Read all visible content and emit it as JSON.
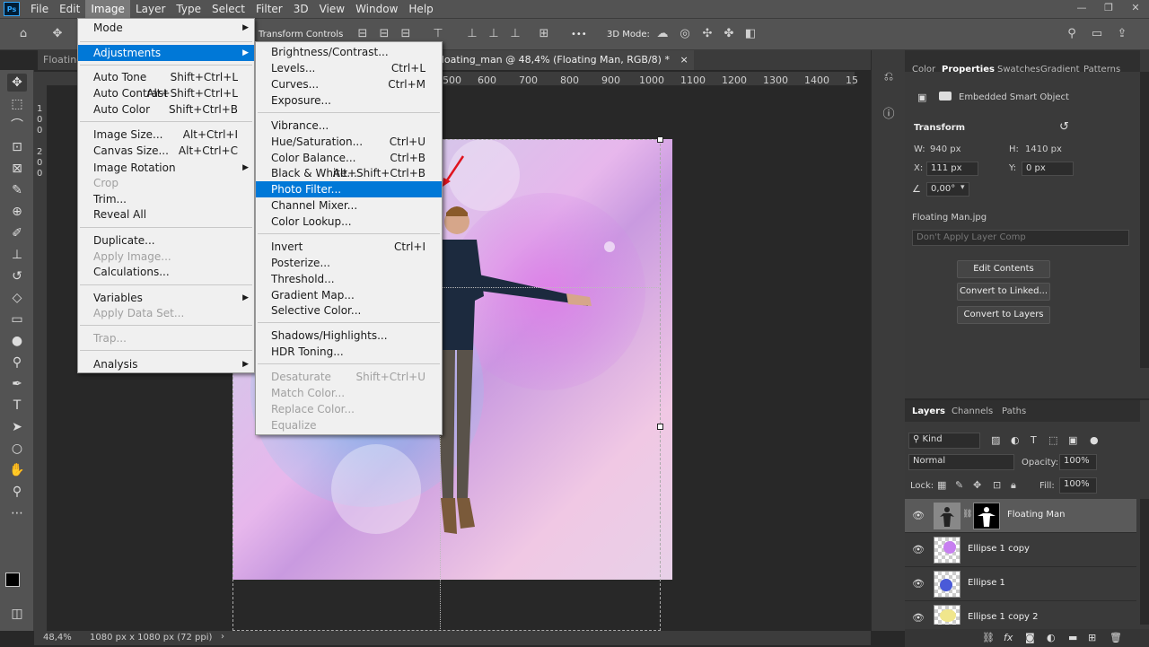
{
  "app": {
    "logo": "Ps"
  },
  "menubar": [
    "File",
    "Edit",
    "Image",
    "Layer",
    "Type",
    "Select",
    "Filter",
    "3D",
    "View",
    "Window",
    "Help"
  ],
  "window_controls": [
    "—",
    "❐",
    "✕"
  ],
  "options": {
    "transform_controls": "Transform Controls",
    "mode_3d": "3D Mode:",
    "more": "•••"
  },
  "tabs": {
    "left_tab": "Floating",
    "doc_tab": "floating_man @ 48,4% (Floating Man, RGB/8) *",
    "close": "×"
  },
  "ruler_top": [
    "500",
    "600",
    "700",
    "800",
    "900",
    "1000",
    "1100",
    "1200",
    "1300",
    "1400",
    "15"
  ],
  "ruler_left": [
    "1",
    "0",
    "0",
    "2",
    "0",
    "0"
  ],
  "status": {
    "zoom": "48,4%",
    "doc_info": "1080 px x 1080 px (72 ppi)",
    "arrow": "›"
  },
  "image_menu": {
    "items": [
      {
        "label": "Mode",
        "arrow": "▶"
      },
      {
        "label": "Adjustments",
        "arrow": "▶",
        "highlight": true
      },
      {
        "label": "Auto Tone",
        "shortcut": "Shift+Ctrl+L"
      },
      {
        "label": "Auto Contrast",
        "shortcut": "Alt+Shift+Ctrl+L"
      },
      {
        "label": "Auto Color",
        "shortcut": "Shift+Ctrl+B"
      },
      {
        "label": "Image Size...",
        "shortcut": "Alt+Ctrl+I"
      },
      {
        "label": "Canvas Size...",
        "shortcut": "Alt+Ctrl+C"
      },
      {
        "label": "Image Rotation",
        "arrow": "▶"
      },
      {
        "label": "Crop",
        "disabled": true
      },
      {
        "label": "Trim..."
      },
      {
        "label": "Reveal All"
      },
      {
        "label": "Duplicate..."
      },
      {
        "label": "Apply Image...",
        "disabled": true
      },
      {
        "label": "Calculations..."
      },
      {
        "label": "Variables",
        "arrow": "▶"
      },
      {
        "label": "Apply Data Set...",
        "disabled": true
      },
      {
        "label": "Trap...",
        "disabled": true
      },
      {
        "label": "Analysis",
        "arrow": "▶"
      }
    ]
  },
  "adjustments_menu": {
    "items": [
      {
        "label": "Brightness/Contrast..."
      },
      {
        "label": "Levels...",
        "shortcut": "Ctrl+L"
      },
      {
        "label": "Curves...",
        "shortcut": "Ctrl+M"
      },
      {
        "label": "Exposure..."
      },
      {
        "label": "Vibrance..."
      },
      {
        "label": "Hue/Saturation...",
        "shortcut": "Ctrl+U"
      },
      {
        "label": "Color Balance...",
        "shortcut": "Ctrl+B"
      },
      {
        "label": "Black & White...",
        "shortcut": "Alt+Shift+Ctrl+B"
      },
      {
        "label": "Photo Filter...",
        "highlight": true
      },
      {
        "label": "Channel Mixer..."
      },
      {
        "label": "Color Lookup..."
      },
      {
        "label": "Invert",
        "shortcut": "Ctrl+I"
      },
      {
        "label": "Posterize..."
      },
      {
        "label": "Threshold..."
      },
      {
        "label": "Gradient Map..."
      },
      {
        "label": "Selective Color..."
      },
      {
        "label": "Shadows/Highlights..."
      },
      {
        "label": "HDR Toning..."
      },
      {
        "label": "Desaturate",
        "shortcut": "Shift+Ctrl+U",
        "disabled": true
      },
      {
        "label": "Match Color...",
        "disabled": true
      },
      {
        "label": "Replace Color...",
        "disabled": true
      },
      {
        "label": "Equalize",
        "disabled": true
      }
    ]
  },
  "properties_panel": {
    "tabs": [
      "Color",
      "Properties",
      "Swatches",
      "Gradient",
      "Patterns"
    ],
    "object_type": "Embedded Smart Object",
    "transform_title": "Transform",
    "w_label": "W:",
    "w_value": "940 px",
    "h_label": "H:",
    "h_value": "1410 px",
    "x_label": "X:",
    "x_value": "111 px",
    "y_label": "Y:",
    "y_value": "0 px",
    "angle": "0,00°",
    "linked_file": "Floating Man.jpg",
    "layer_comp_placeholder": "Don't Apply Layer Comp",
    "buttons": [
      "Edit Contents",
      "Convert to Linked...",
      "Convert to Layers"
    ]
  },
  "layers_panel": {
    "tabs": [
      "Layers",
      "Channels",
      "Paths"
    ],
    "kind": "Kind",
    "blend_mode": "Normal",
    "opacity_label": "Opacity:",
    "opacity_value": "100%",
    "lock_label": "Lock:",
    "fill_label": "Fill:",
    "fill_value": "100%",
    "layers": [
      {
        "name": "Floating Man",
        "selected": true
      },
      {
        "name": "Ellipse 1 copy"
      },
      {
        "name": "Ellipse 1"
      },
      {
        "name": "Ellipse 1 copy 2"
      }
    ],
    "footer_icons": [
      "link-icon",
      "fx-icon",
      "mask-icon",
      "adjustment-icon",
      "group-icon",
      "new-layer-icon",
      "trash-icon"
    ]
  },
  "colors": {
    "accent": "#0078d7",
    "ps_blue": "#31a8ff",
    "annotation_red": "#e0141e"
  }
}
